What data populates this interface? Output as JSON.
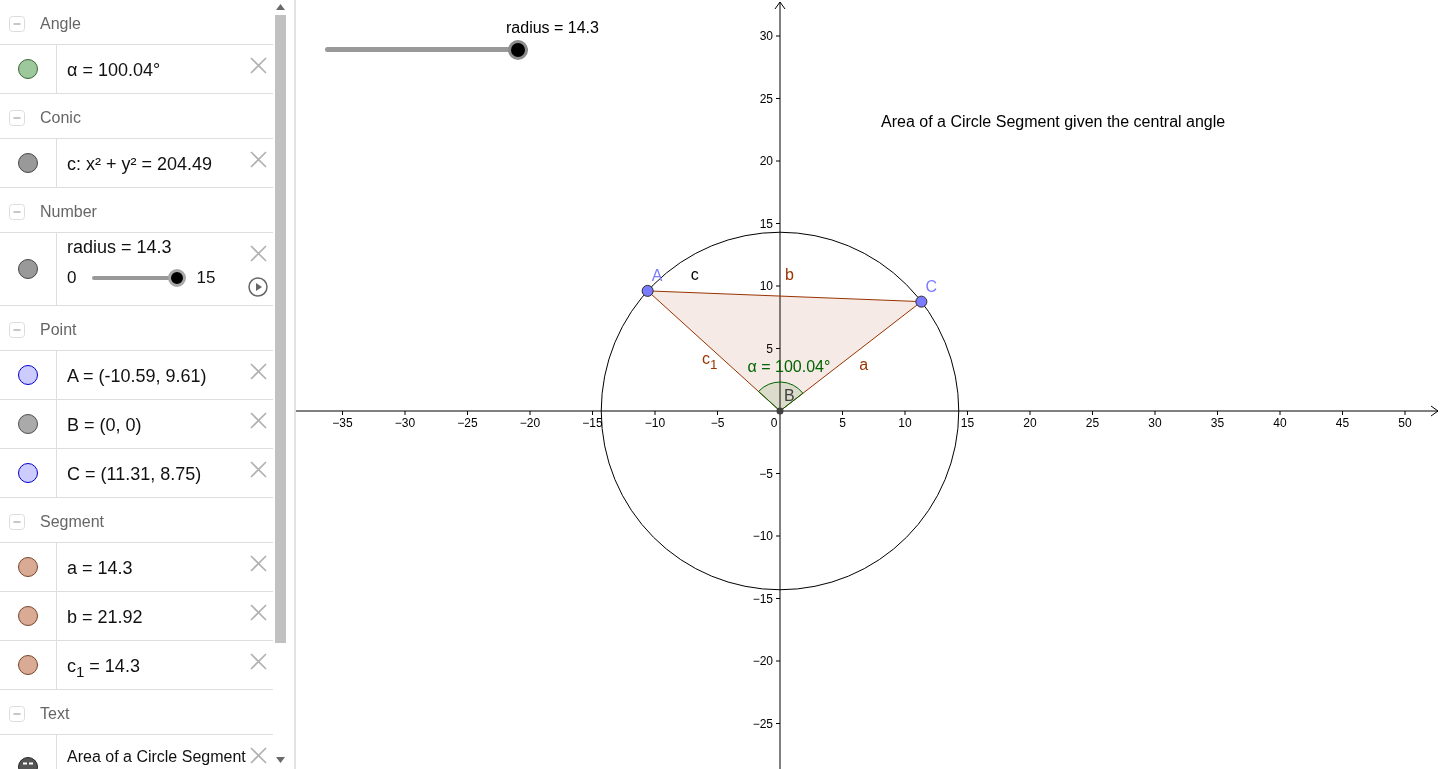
{
  "algebra_view": {
    "groups": [
      {
        "title": "Angle",
        "expanded": true,
        "items": [
          {
            "kind": "value",
            "text": "α = 100.04°",
            "color": "#9cc89c"
          }
        ]
      },
      {
        "title": "Conic",
        "expanded": true,
        "items": [
          {
            "kind": "value",
            "text": "c: x² + y² = 204.49",
            "color": "#999999"
          }
        ]
      },
      {
        "title": "Number",
        "expanded": true,
        "items": [
          {
            "kind": "slider",
            "text": "radius = 14.3",
            "min": "0",
            "max": "15",
            "level": 0.953,
            "color": "#999999"
          }
        ]
      },
      {
        "title": "Point",
        "expanded": true,
        "items": [
          {
            "kind": "value",
            "text": "A = (-10.59, 9.61)",
            "color": "#ccccff"
          },
          {
            "kind": "value",
            "text": "B = (0, 0)",
            "color": "#aaaaaa"
          },
          {
            "kind": "value",
            "text": "C = (11.31, 8.75)",
            "color": "#ccccff"
          }
        ]
      },
      {
        "title": "Segment",
        "expanded": true,
        "items": [
          {
            "kind": "value",
            "text": "a = 14.3",
            "color": "#d9aa94"
          },
          {
            "kind": "value",
            "text": "b = 21.92",
            "color": "#d9aa94"
          },
          {
            "kind": "value",
            "text": "c$_{1}$ = 14.3",
            "color": "#d9aa94"
          }
        ]
      },
      {
        "title": "Text",
        "expanded": true,
        "items": [
          {
            "kind": "text",
            "text": "Area of a Circle Segment",
            "color": "#555555"
          }
        ]
      }
    ]
  },
  "graphics_view": {
    "slider": {
      "label": "radius = 14.3",
      "level": 0.953
    },
    "caption": "Area of a Circle Segment given the central angle",
    "chart_data": {
      "type": "scatter",
      "x": [
        -10.59,
        0,
        11.31
      ],
      "series": [
        {
          "name": "A",
          "color": "#7b7bff",
          "values": [
            9.61,
            null,
            null
          ]
        },
        {
          "name": "B",
          "color": "#404040",
          "values": [
            null,
            0,
            null
          ]
        },
        {
          "name": "C",
          "color": "#7b7bff",
          "values": [
            null,
            null,
            8.75
          ]
        }
      ],
      "xlim": [
        -38.72,
        52.8
      ],
      "ylim": [
        -28.64,
        32.88
      ],
      "xticks": [
        {
          "value": -35,
          "label": "−35"
        },
        {
          "value": -30,
          "label": "−30"
        },
        {
          "value": -25,
          "label": "−25"
        },
        {
          "value": -20,
          "label": "−20"
        },
        {
          "value": -15,
          "label": "−15"
        },
        {
          "value": -10,
          "label": "−10"
        },
        {
          "value": -5,
          "label": "−5"
        },
        0,
        5,
        10,
        15,
        20,
        25,
        30,
        35,
        40,
        45,
        50
      ],
      "yticks": [
        {
          "value": -25,
          "label": "−25"
        },
        {
          "value": -20,
          "label": "−20"
        },
        {
          "value": -15,
          "label": "−15"
        },
        {
          "value": -10,
          "label": "−10"
        },
        {
          "value": -5,
          "label": "−5"
        },
        5,
        10,
        15,
        20,
        25,
        30
      ],
      "annotations": [
        "c",
        "b",
        "c$_{1}$",
        "a",
        "α = 100.04°"
      ]
    }
  }
}
